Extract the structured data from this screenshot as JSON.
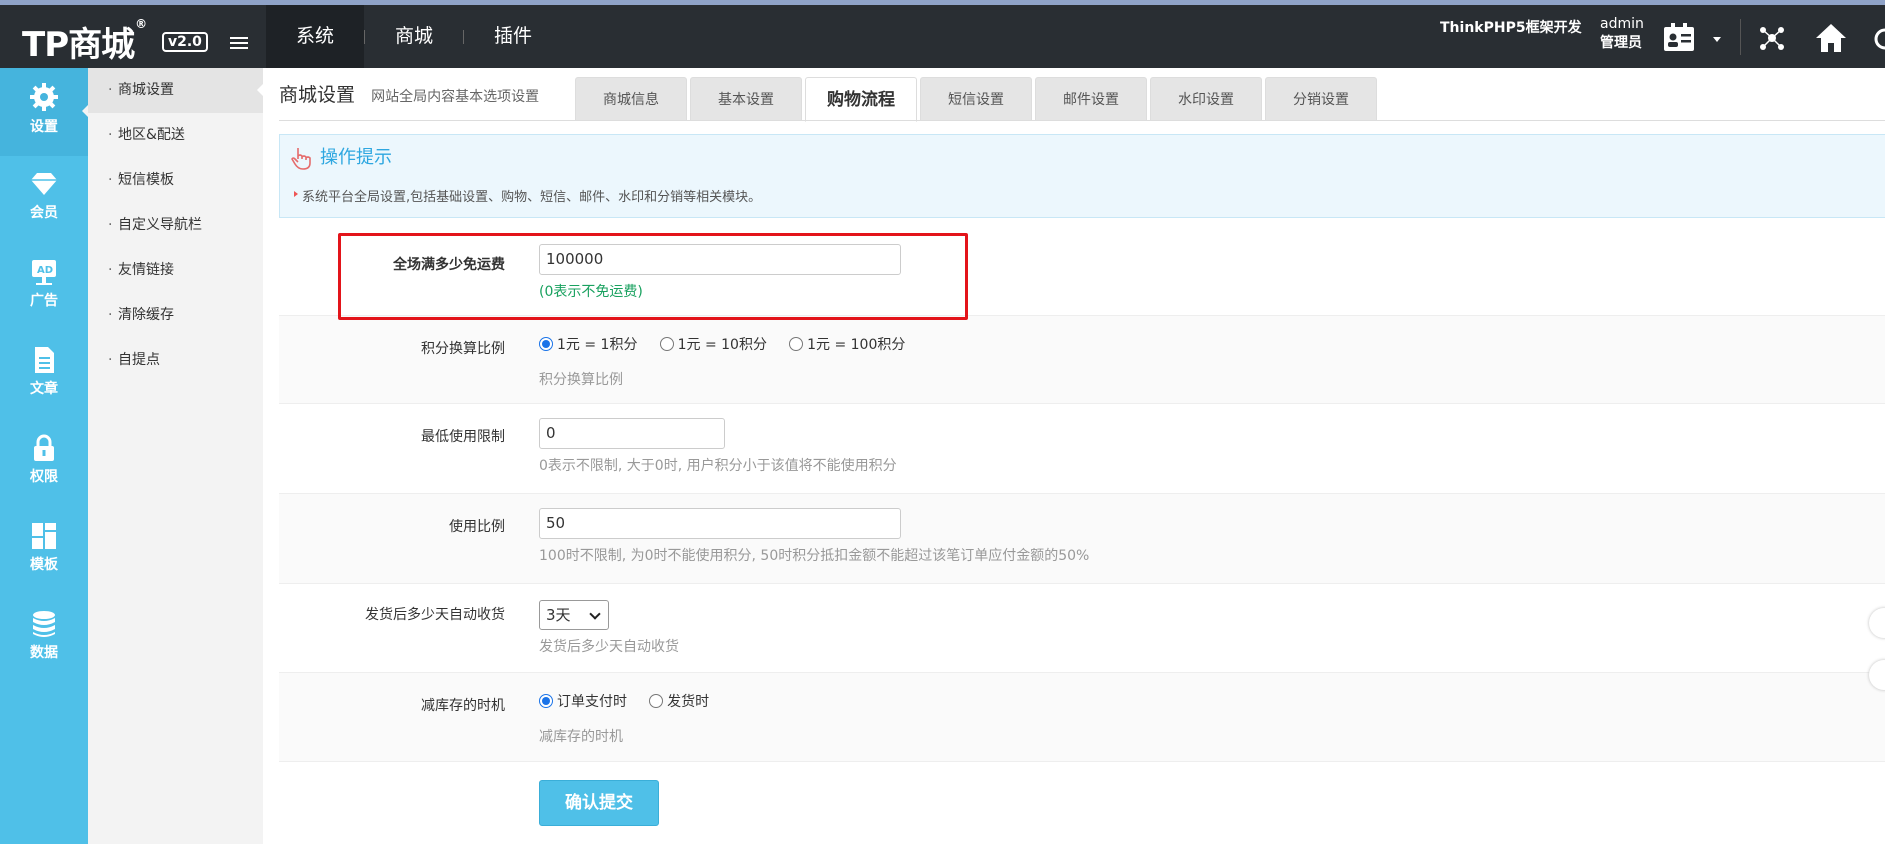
{
  "header": {
    "logo": "TP商城",
    "logo_reg": "®",
    "version": "v2.0",
    "nav": [
      "系统",
      "商城",
      "插件"
    ],
    "dev_text": "ThinkPHP5框架开发",
    "user_name": "admin",
    "user_role": "管理员"
  },
  "sidebar": {
    "items": [
      {
        "label": "设置",
        "icon": "gear-icon"
      },
      {
        "label": "会员",
        "icon": "diamond-icon"
      },
      {
        "label": "广告",
        "icon": "ad-icon"
      },
      {
        "label": "文章",
        "icon": "document-icon"
      },
      {
        "label": "权限",
        "icon": "lock-icon"
      },
      {
        "label": "模板",
        "icon": "grid-icon"
      },
      {
        "label": "数据",
        "icon": "database-icon"
      }
    ]
  },
  "submenu": {
    "items": [
      "商城设置",
      "地区&配送",
      "短信模板",
      "自定义导航栏",
      "友情链接",
      "清除缓存",
      "自提点"
    ]
  },
  "page": {
    "title": "商城设置",
    "subtitle": "网站全局内容基本选项设置"
  },
  "tabs": [
    "商城信息",
    "基本设置",
    "购物流程",
    "短信设置",
    "邮件设置",
    "水印设置",
    "分销设置"
  ],
  "tips": {
    "title": "操作提示",
    "text": "系统平台全局设置,包括基础设置、购物、短信、邮件、水印和分销等相关模块。"
  },
  "form": {
    "free_shipping": {
      "label": "全场满多少免运费",
      "value": "100000",
      "hint": "(0表示不免运费)"
    },
    "points_ratio": {
      "label": "积分换算比例",
      "options": [
        "1元 = 1积分",
        "1元 = 10积分",
        "1元 = 100积分"
      ],
      "selected": 0,
      "hint": "积分换算比例"
    },
    "min_limit": {
      "label": "最低使用限制",
      "value": "0",
      "hint": "0表示不限制, 大于0时, 用户积分小于该值将不能使用积分"
    },
    "use_ratio": {
      "label": "使用比例",
      "value": "50",
      "hint": "100时不限制, 为0时不能使用积分, 50时积分抵扣金额不能超过该笔订单应付金额的50%"
    },
    "auto_receive": {
      "label": "发货后多少天自动收货",
      "value": "3天",
      "hint": "发货后多少天自动收货"
    },
    "stock_timing": {
      "label": "减库存的时机",
      "options": [
        "订单支付时",
        "发货时"
      ],
      "selected": 0,
      "hint": "减库存的时机"
    },
    "submit": "确认提交"
  }
}
